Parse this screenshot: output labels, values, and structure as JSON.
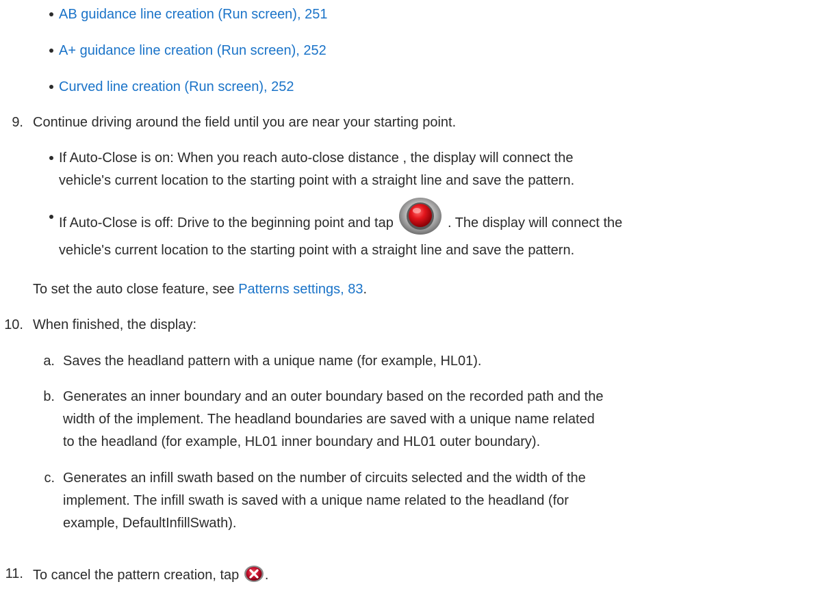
{
  "links": {
    "ab_guidance": "AB guidance line creation (Run screen), 251",
    "aplus_guidance": "A+ guidance line creation (Run screen), 252",
    "curved_line": "Curved line creation (Run screen), 252"
  },
  "step9": {
    "number": "9.",
    "text": "Continue driving around the field until you are near your starting point.",
    "auto_close_on_1": "If Auto-Close is on: When you reach auto-close distance , the display will connect the",
    "auto_close_on_2": "vehicle's current location to the starting point with a straight line and save the pattern.",
    "auto_close_off_a": "If Auto-Close is off: Drive to the beginning point and tap",
    "auto_close_off_b": ". The display will connect the",
    "auto_close_off_2": "vehicle's current location to the starting point with a straight line and save the pattern.",
    "note_prefix": "To set the auto close feature, see ",
    "note_link": "Patterns settings, 83",
    "note_suffix": "."
  },
  "step10": {
    "number": "10.",
    "text": "When finished, the display:",
    "a_label": "a.",
    "a_text": "Saves the headland pattern with a unique name (for example, HL01).",
    "b_label": "b.",
    "b_line1": "Generates an inner boundary and an outer boundary based on the recorded path and the",
    "b_line2": "width of the implement. The headland boundaries are saved with a unique name related",
    "b_line3": "to the headland (for example, HL01 inner boundary and HL01 outer boundary).",
    "c_label": "c.",
    "c_line1": "Generates an infill swath based on the number of circuits selected and the width of the",
    "c_line2": "implement. The infill swath is saved with a unique name related to the headland (for",
    "c_line3": "example, DefaultInfillSwath)."
  },
  "step11": {
    "number": "11.",
    "text_a": "To cancel the pattern creation, tap",
    "text_b": "."
  },
  "icons": {
    "record": "record-button-icon",
    "cancel": "cancel-x-icon"
  },
  "colors": {
    "link": "#1a73c8",
    "text": "#2b2b2b",
    "record_red": "#d8141c",
    "cancel_red": "#c8102e"
  }
}
